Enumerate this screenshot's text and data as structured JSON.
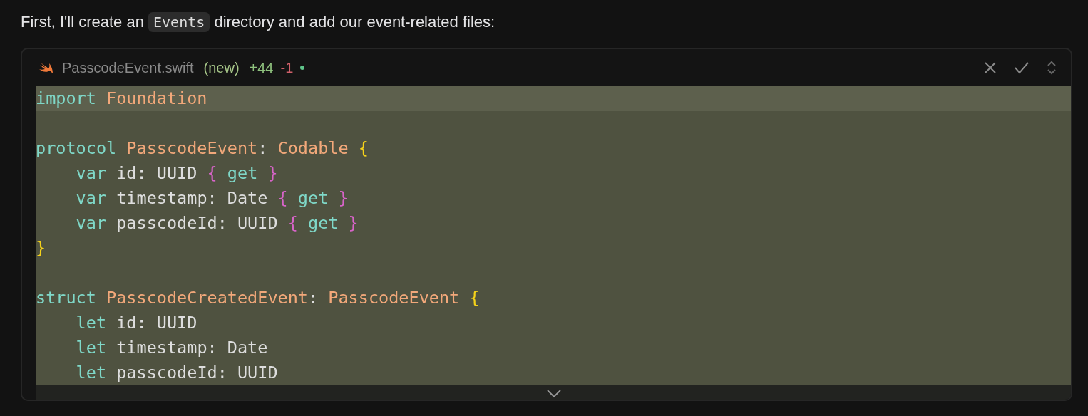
{
  "message": {
    "before": "First, I'll create an ",
    "code": "Events",
    "after": " directory and add our event-related files:"
  },
  "file": {
    "name": "PasscodeEvent.swift",
    "status": "(new)",
    "added": "+44",
    "removed": "-1"
  },
  "code_lines": [
    {
      "highlighted": true,
      "tokens": [
        {
          "kind": "keyword",
          "text": "import"
        },
        {
          "kind": "type",
          "text": " Foundation"
        }
      ]
    },
    {
      "highlighted": false
    },
    {
      "highlighted": false,
      "tokens": [
        {
          "kind": "keyword",
          "text": "protocol"
        },
        {
          "kind": "type",
          "text": " PasscodeEvent"
        },
        {
          "kind": "plain",
          "text": ": "
        },
        {
          "kind": "type",
          "text": "Codable"
        },
        {
          "kind": "brace",
          "text": " {"
        }
      ]
    },
    {
      "highlighted": false,
      "tokens": [
        {
          "kind": "keyword",
          "text": "    var"
        },
        {
          "kind": "plain",
          "text": " id: UUID"
        },
        {
          "kind": "inner",
          "text": " {"
        },
        {
          "kind": "keyword",
          "text": " get"
        },
        {
          "kind": "inner",
          "text": " }"
        }
      ]
    },
    {
      "highlighted": false,
      "tokens": [
        {
          "kind": "keyword",
          "text": "    var"
        },
        {
          "kind": "plain",
          "text": " timestamp: Date"
        },
        {
          "kind": "inner",
          "text": " {"
        },
        {
          "kind": "keyword",
          "text": " get"
        },
        {
          "kind": "inner",
          "text": " }"
        }
      ]
    },
    {
      "highlighted": false,
      "tokens": [
        {
          "kind": "keyword",
          "text": "    var"
        },
        {
          "kind": "plain",
          "text": " passcodeId: UUID"
        },
        {
          "kind": "inner",
          "text": " {"
        },
        {
          "kind": "keyword",
          "text": " get"
        },
        {
          "kind": "inner",
          "text": " }"
        }
      ]
    },
    {
      "highlighted": false,
      "tokens": [
        {
          "kind": "brace",
          "text": "}"
        }
      ]
    },
    {
      "highlighted": false
    },
    {
      "highlighted": false,
      "tokens": [
        {
          "kind": "keyword",
          "text": "struct"
        },
        {
          "kind": "type",
          "text": " PasscodeCreatedEvent"
        },
        {
          "kind": "plain",
          "text": ": "
        },
        {
          "kind": "type",
          "text": "PasscodeEvent"
        },
        {
          "kind": "brace",
          "text": " {"
        }
      ]
    },
    {
      "highlighted": false,
      "tokens": [
        {
          "kind": "keyword",
          "text": "    let"
        },
        {
          "kind": "plain",
          "text": " id: UUID"
        }
      ]
    },
    {
      "highlighted": false,
      "tokens": [
        {
          "kind": "keyword",
          "text": "    let"
        },
        {
          "kind": "plain",
          "text": " timestamp: Date"
        }
      ]
    },
    {
      "highlighted": false,
      "tokens": [
        {
          "kind": "keyword",
          "text": "    let"
        },
        {
          "kind": "plain",
          "text": " passcodeId: UUID"
        }
      ]
    }
  ]
}
